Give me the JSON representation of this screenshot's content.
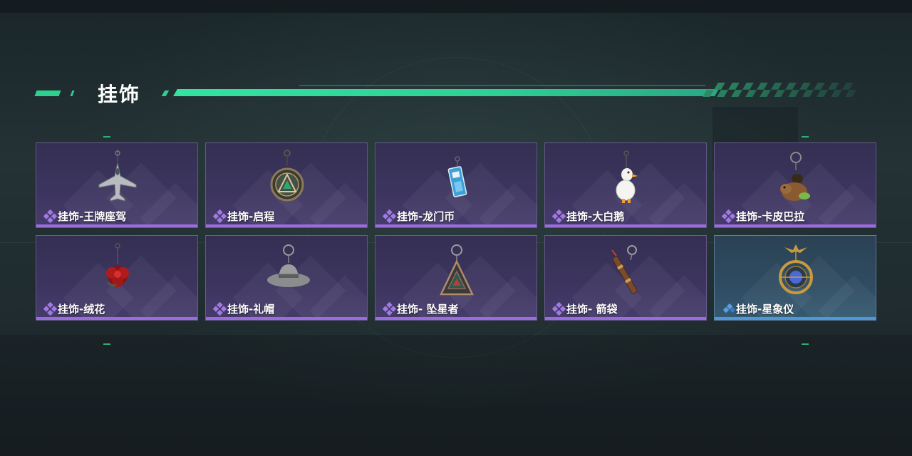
{
  "header": {
    "title": "挂饰"
  },
  "colors": {
    "accent": "#2ed08f",
    "rarity_purple": "#9a6cdc",
    "rarity_blue": "#4e98d8"
  },
  "items": [
    {
      "name": "挂饰-王牌座驾",
      "rarity": "purple",
      "icon": "jet-plane-charm-icon"
    },
    {
      "name": "挂饰-启程",
      "rarity": "purple",
      "icon": "round-medallion-charm-icon"
    },
    {
      "name": "挂饰-龙门币",
      "rarity": "purple",
      "icon": "card-tag-charm-icon"
    },
    {
      "name": "挂饰-大白鹅",
      "rarity": "purple",
      "icon": "white-goose-charm-icon"
    },
    {
      "name": "挂饰-卡皮巴拉",
      "rarity": "purple",
      "icon": "capybara-charm-icon"
    },
    {
      "name": "挂饰-绒花",
      "rarity": "purple",
      "icon": "red-flower-charm-icon"
    },
    {
      "name": "挂饰-礼帽",
      "rarity": "purple",
      "icon": "grey-hat-charm-icon"
    },
    {
      "name": "挂饰- 坠星者",
      "rarity": "purple",
      "icon": "triangle-pendant-charm-icon"
    },
    {
      "name": "挂饰- 箭袋",
      "rarity": "purple",
      "icon": "arrow-quiver-charm-icon"
    },
    {
      "name": "挂饰-星象仪",
      "rarity": "blue",
      "icon": "astrolabe-charm-icon"
    }
  ]
}
